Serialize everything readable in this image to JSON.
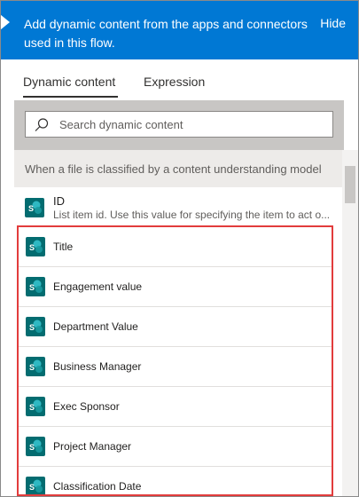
{
  "header": {
    "text": "Add dynamic content from the apps and connectors used in this flow.",
    "hide_label": "Hide"
  },
  "tabs": [
    {
      "label": "Dynamic content",
      "active": true
    },
    {
      "label": "Expression",
      "active": false
    }
  ],
  "search": {
    "placeholder": "Search dynamic content",
    "value": ""
  },
  "section": {
    "title": "When a file is classified by a content understanding model"
  },
  "id_item": {
    "title": "ID",
    "description": "List item id. Use this value for specifying the item to act o..."
  },
  "items": [
    {
      "label": "Title",
      "icon": "sharepoint-icon"
    },
    {
      "label": "Engagement value",
      "icon": "sharepoint-icon"
    },
    {
      "label": "Department Value",
      "icon": "sharepoint-icon"
    },
    {
      "label": "Business Manager",
      "icon": "sharepoint-icon"
    },
    {
      "label": "Exec Sponsor",
      "icon": "sharepoint-icon"
    },
    {
      "label": "Project Manager",
      "icon": "sharepoint-icon"
    },
    {
      "label": "Classification Date",
      "icon": "sharepoint-icon"
    }
  ],
  "colors": {
    "header_bg": "#0078d4",
    "highlight_border": "#e23c3c",
    "sharepoint_teal": "#036c70"
  }
}
